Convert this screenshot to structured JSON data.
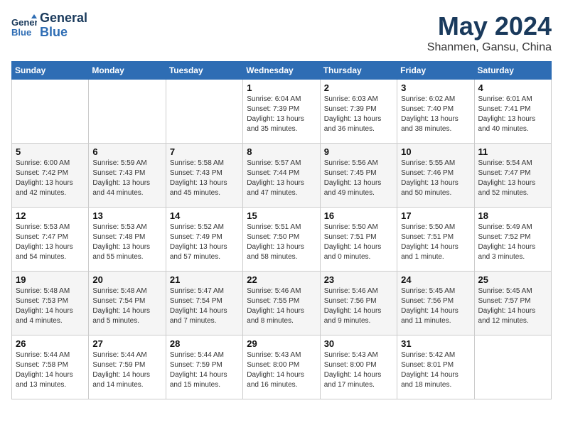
{
  "header": {
    "logo_line1": "General",
    "logo_line2": "Blue",
    "month": "May 2024",
    "location": "Shanmen, Gansu, China"
  },
  "weekdays": [
    "Sunday",
    "Monday",
    "Tuesday",
    "Wednesday",
    "Thursday",
    "Friday",
    "Saturday"
  ],
  "weeks": [
    [
      {
        "day": "",
        "info": ""
      },
      {
        "day": "",
        "info": ""
      },
      {
        "day": "",
        "info": ""
      },
      {
        "day": "1",
        "info": "Sunrise: 6:04 AM\nSunset: 7:39 PM\nDaylight: 13 hours\nand 35 minutes."
      },
      {
        "day": "2",
        "info": "Sunrise: 6:03 AM\nSunset: 7:39 PM\nDaylight: 13 hours\nand 36 minutes."
      },
      {
        "day": "3",
        "info": "Sunrise: 6:02 AM\nSunset: 7:40 PM\nDaylight: 13 hours\nand 38 minutes."
      },
      {
        "day": "4",
        "info": "Sunrise: 6:01 AM\nSunset: 7:41 PM\nDaylight: 13 hours\nand 40 minutes."
      }
    ],
    [
      {
        "day": "5",
        "info": "Sunrise: 6:00 AM\nSunset: 7:42 PM\nDaylight: 13 hours\nand 42 minutes."
      },
      {
        "day": "6",
        "info": "Sunrise: 5:59 AM\nSunset: 7:43 PM\nDaylight: 13 hours\nand 44 minutes."
      },
      {
        "day": "7",
        "info": "Sunrise: 5:58 AM\nSunset: 7:43 PM\nDaylight: 13 hours\nand 45 minutes."
      },
      {
        "day": "8",
        "info": "Sunrise: 5:57 AM\nSunset: 7:44 PM\nDaylight: 13 hours\nand 47 minutes."
      },
      {
        "day": "9",
        "info": "Sunrise: 5:56 AM\nSunset: 7:45 PM\nDaylight: 13 hours\nand 49 minutes."
      },
      {
        "day": "10",
        "info": "Sunrise: 5:55 AM\nSunset: 7:46 PM\nDaylight: 13 hours\nand 50 minutes."
      },
      {
        "day": "11",
        "info": "Sunrise: 5:54 AM\nSunset: 7:47 PM\nDaylight: 13 hours\nand 52 minutes."
      }
    ],
    [
      {
        "day": "12",
        "info": "Sunrise: 5:53 AM\nSunset: 7:47 PM\nDaylight: 13 hours\nand 54 minutes."
      },
      {
        "day": "13",
        "info": "Sunrise: 5:53 AM\nSunset: 7:48 PM\nDaylight: 13 hours\nand 55 minutes."
      },
      {
        "day": "14",
        "info": "Sunrise: 5:52 AM\nSunset: 7:49 PM\nDaylight: 13 hours\nand 57 minutes."
      },
      {
        "day": "15",
        "info": "Sunrise: 5:51 AM\nSunset: 7:50 PM\nDaylight: 13 hours\nand 58 minutes."
      },
      {
        "day": "16",
        "info": "Sunrise: 5:50 AM\nSunset: 7:51 PM\nDaylight: 14 hours\nand 0 minutes."
      },
      {
        "day": "17",
        "info": "Sunrise: 5:50 AM\nSunset: 7:51 PM\nDaylight: 14 hours\nand 1 minute."
      },
      {
        "day": "18",
        "info": "Sunrise: 5:49 AM\nSunset: 7:52 PM\nDaylight: 14 hours\nand 3 minutes."
      }
    ],
    [
      {
        "day": "19",
        "info": "Sunrise: 5:48 AM\nSunset: 7:53 PM\nDaylight: 14 hours\nand 4 minutes."
      },
      {
        "day": "20",
        "info": "Sunrise: 5:48 AM\nSunset: 7:54 PM\nDaylight: 14 hours\nand 5 minutes."
      },
      {
        "day": "21",
        "info": "Sunrise: 5:47 AM\nSunset: 7:54 PM\nDaylight: 14 hours\nand 7 minutes."
      },
      {
        "day": "22",
        "info": "Sunrise: 5:46 AM\nSunset: 7:55 PM\nDaylight: 14 hours\nand 8 minutes."
      },
      {
        "day": "23",
        "info": "Sunrise: 5:46 AM\nSunset: 7:56 PM\nDaylight: 14 hours\nand 9 minutes."
      },
      {
        "day": "24",
        "info": "Sunrise: 5:45 AM\nSunset: 7:56 PM\nDaylight: 14 hours\nand 11 minutes."
      },
      {
        "day": "25",
        "info": "Sunrise: 5:45 AM\nSunset: 7:57 PM\nDaylight: 14 hours\nand 12 minutes."
      }
    ],
    [
      {
        "day": "26",
        "info": "Sunrise: 5:44 AM\nSunset: 7:58 PM\nDaylight: 14 hours\nand 13 minutes."
      },
      {
        "day": "27",
        "info": "Sunrise: 5:44 AM\nSunset: 7:59 PM\nDaylight: 14 hours\nand 14 minutes."
      },
      {
        "day": "28",
        "info": "Sunrise: 5:44 AM\nSunset: 7:59 PM\nDaylight: 14 hours\nand 15 minutes."
      },
      {
        "day": "29",
        "info": "Sunrise: 5:43 AM\nSunset: 8:00 PM\nDaylight: 14 hours\nand 16 minutes."
      },
      {
        "day": "30",
        "info": "Sunrise: 5:43 AM\nSunset: 8:00 PM\nDaylight: 14 hours\nand 17 minutes."
      },
      {
        "day": "31",
        "info": "Sunrise: 5:42 AM\nSunset: 8:01 PM\nDaylight: 14 hours\nand 18 minutes."
      },
      {
        "day": "",
        "info": ""
      }
    ]
  ]
}
